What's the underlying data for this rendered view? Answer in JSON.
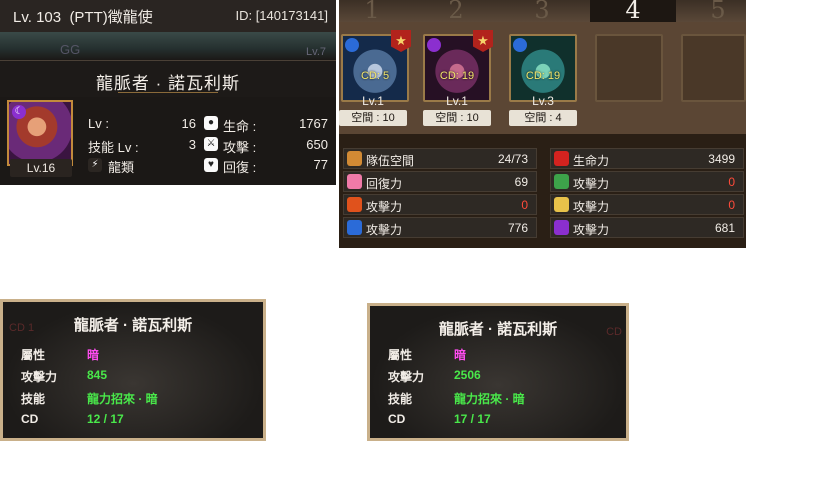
{
  "card": {
    "player_level": "Lv. 103",
    "player_name": "(PTT)徵龍使",
    "player_id": "ID: [140173141]",
    "ghost_text": "GG",
    "ghost_level": "Lv.7",
    "card_name": "龍脈者 · 諾瓦利斯",
    "portrait_level": "Lv.16",
    "stats": {
      "lv_label": "Lv :",
      "lv_value": "16",
      "skill_label": "技能 Lv :",
      "skill_value": "3",
      "race_label": "龍類",
      "hp_label": "生命 :",
      "hp_value": "1767",
      "atk_label": "攻擊 :",
      "atk_value": "650",
      "rec_label": "回復 :",
      "rec_value": "77"
    }
  },
  "team": {
    "slot_numbers": [
      "1",
      "2",
      "3",
      "4",
      "5"
    ],
    "active_slot": "4",
    "members": [
      {
        "cd": "CD: 5",
        "level": "Lv.1",
        "space": "空間 : 10"
      },
      {
        "cd": "CD: 19",
        "level": "Lv.1",
        "space": "空間 : 10"
      },
      {
        "cd": "CD: 19",
        "level": "Lv.3",
        "space": "空間 : 4"
      }
    ],
    "stats": [
      {
        "label": "隊伍空間",
        "value": "24/73",
        "icon": "flag-icon"
      },
      {
        "label": "生命力",
        "value": "3499",
        "icon": "heart-red-icon"
      },
      {
        "label": "回復力",
        "value": "69",
        "icon": "heart-pink-icon"
      },
      {
        "label": "攻擊力",
        "value": "0",
        "icon": "wood-element-icon"
      },
      {
        "label": "攻擊力",
        "value": "0",
        "icon": "fire-element-icon"
      },
      {
        "label": "攻擊力",
        "value": "0",
        "icon": "light-element-icon"
      },
      {
        "label": "攻擊力",
        "value": "776",
        "icon": "water-element-icon"
      },
      {
        "label": "攻擊力",
        "value": "681",
        "icon": "dark-element-icon"
      }
    ]
  },
  "tooltips": [
    {
      "title": "龍脈者 · 諾瓦利斯",
      "ghost": "CD 1",
      "attr_label": "屬性",
      "attr_value": "暗",
      "atk_label": "攻擊力",
      "atk_value": "845",
      "skill_label": "技能",
      "skill_value": "龍力招來 · 暗",
      "cd_label": "CD",
      "cd_value": "12  /  17"
    },
    {
      "title": "龍脈者 · 諾瓦利斯",
      "ghost": "CD",
      "attr_label": "屬性",
      "attr_value": "暗",
      "atk_label": "攻擊力",
      "atk_value": "2506",
      "skill_label": "技能",
      "skill_value": "龍力招來 · 暗",
      "cd_label": "CD",
      "cd_value": "17  /  17"
    }
  ],
  "colors": {
    "dark_attr": "#ff4cf0",
    "value_green": "#49e84a",
    "zero_red": "#ff4b3a",
    "frame_gold": "#c9b08a"
  }
}
